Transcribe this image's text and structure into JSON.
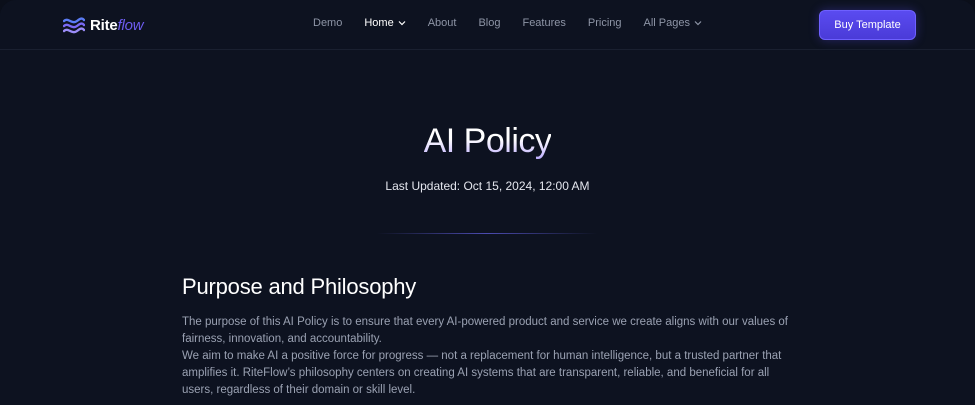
{
  "brand": {
    "name_main": "Rite",
    "name_accent": "flow",
    "accent_color": "#6d5cf0"
  },
  "nav": {
    "items": [
      {
        "label": "Demo",
        "active": false,
        "dropdown": false
      },
      {
        "label": "Home",
        "active": true,
        "dropdown": true
      },
      {
        "label": "About",
        "active": false,
        "dropdown": false
      },
      {
        "label": "Blog",
        "active": false,
        "dropdown": false
      },
      {
        "label": "Features",
        "active": false,
        "dropdown": false
      },
      {
        "label": "Pricing",
        "active": false,
        "dropdown": false
      },
      {
        "label": "All Pages",
        "active": false,
        "dropdown": true
      }
    ],
    "cta_label": "Buy Template"
  },
  "hero": {
    "title": "AI Policy",
    "updated": "Last Updated: Oct 15, 2024, 12:00 AM"
  },
  "section": {
    "title": "Purpose and Philosophy",
    "paragraph_1": "The purpose of this AI Policy is to ensure that every AI-powered product and service we create aligns with our values of fairness, innovation, and accountability.",
    "paragraph_2": "We aim to make AI a positive force for progress — not a replacement for human intelligence, but a trusted partner that amplifies it. RiteFlow’s philosophy centers on creating AI systems that are transparent, reliable, and beneficial for all users, regardless of their domain or skill level."
  }
}
